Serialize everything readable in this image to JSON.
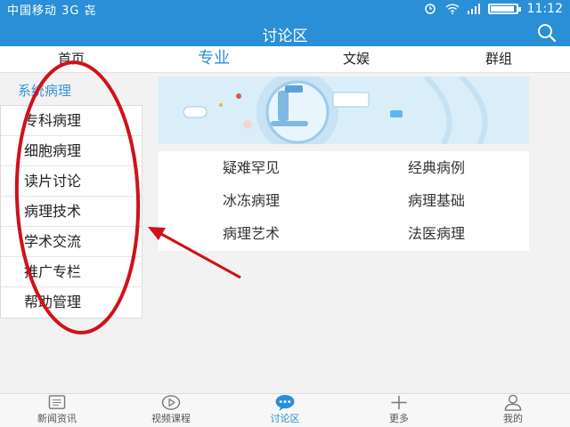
{
  "status_bar": {
    "carrier": "中国移动 3G 㐂",
    "time": "11:12"
  },
  "header": {
    "title": "讨论区"
  },
  "tabs": [
    {
      "label": "首页"
    },
    {
      "label": "专业"
    },
    {
      "label": "文娱"
    },
    {
      "label": "群组"
    }
  ],
  "sidebar": {
    "header": "系统病理",
    "items": [
      {
        "label": "专科病理"
      },
      {
        "label": "细胞病理"
      },
      {
        "label": "读片讨论"
      },
      {
        "label": "病理技术"
      },
      {
        "label": "学术交流"
      },
      {
        "label": "推广专栏"
      },
      {
        "label": "帮助管理"
      }
    ]
  },
  "grid": {
    "items": [
      {
        "label": "疑难罕见"
      },
      {
        "label": "经典病例"
      },
      {
        "label": "冰冻病理"
      },
      {
        "label": "病理基础"
      },
      {
        "label": "病理艺术"
      },
      {
        "label": "法医病理"
      }
    ]
  },
  "bottom_nav": [
    {
      "label": "新闻资讯",
      "icon": "newspaper-icon"
    },
    {
      "label": "视频课程",
      "icon": "play-icon"
    },
    {
      "label": "讨论区",
      "icon": "chat-icon"
    },
    {
      "label": "更多",
      "icon": "plus-icon"
    },
    {
      "label": "我的",
      "icon": "user-icon"
    }
  ],
  "colors": {
    "brand": "#2a8fd6",
    "annotation": "#d0111b"
  }
}
